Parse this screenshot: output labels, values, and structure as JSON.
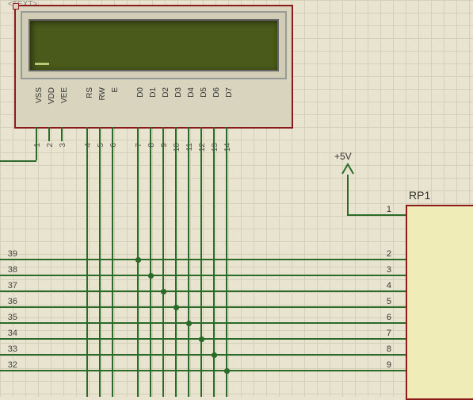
{
  "text_marker": "<TEXT>",
  "lcd": {
    "pin_labels": [
      "VSS",
      "VDD",
      "VEE",
      "RS",
      "RW",
      "E",
      "D0",
      "D1",
      "D2",
      "D3",
      "D4",
      "D5",
      "D6",
      "D7"
    ],
    "pin_numbers": [
      "1",
      "2",
      "3",
      "4",
      "5",
      "6",
      "7",
      "8",
      "9",
      "10",
      "11",
      "12",
      "13",
      "14"
    ]
  },
  "power": {
    "label": "+5V"
  },
  "rp1": {
    "name": "RP1",
    "pins": [
      "1",
      "2",
      "3",
      "4",
      "5",
      "6",
      "7",
      "8",
      "9"
    ]
  },
  "left_pins": [
    "39",
    "38",
    "37",
    "36",
    "35",
    "34",
    "33",
    "32"
  ]
}
